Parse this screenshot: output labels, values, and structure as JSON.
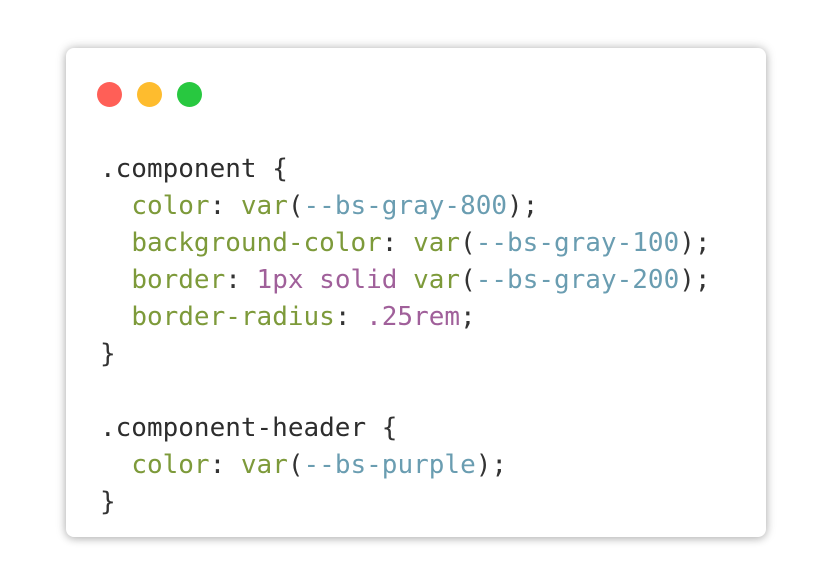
{
  "window": {
    "controls": [
      {
        "name": "close-dot",
        "color": "#ff5f57"
      },
      {
        "name": "minimize-dot",
        "color": "#febc2e"
      },
      {
        "name": "zoom-dot",
        "color": "#28c840"
      }
    ]
  },
  "code": {
    "lines": [
      [
        {
          "t": "sel",
          "v": ".component "
        },
        {
          "t": "punc",
          "v": "{"
        }
      ],
      [
        {
          "t": "punc",
          "v": "  "
        },
        {
          "t": "prop",
          "v": "color"
        },
        {
          "t": "punc",
          "v": ": "
        },
        {
          "t": "func",
          "v": "var"
        },
        {
          "t": "punc",
          "v": "("
        },
        {
          "t": "var",
          "v": "--bs-gray-800"
        },
        {
          "t": "punc",
          "v": ");"
        }
      ],
      [
        {
          "t": "punc",
          "v": "  "
        },
        {
          "t": "prop",
          "v": "background-color"
        },
        {
          "t": "punc",
          "v": ": "
        },
        {
          "t": "func",
          "v": "var"
        },
        {
          "t": "punc",
          "v": "("
        },
        {
          "t": "var",
          "v": "--bs-gray-100"
        },
        {
          "t": "punc",
          "v": ");"
        }
      ],
      [
        {
          "t": "punc",
          "v": "  "
        },
        {
          "t": "prop",
          "v": "border"
        },
        {
          "t": "punc",
          "v": ": "
        },
        {
          "t": "num",
          "v": "1px"
        },
        {
          "t": "punc",
          "v": " "
        },
        {
          "t": "kw",
          "v": "solid"
        },
        {
          "t": "punc",
          "v": " "
        },
        {
          "t": "func",
          "v": "var"
        },
        {
          "t": "punc",
          "v": "("
        },
        {
          "t": "var",
          "v": "--bs-gray-200"
        },
        {
          "t": "punc",
          "v": ");"
        }
      ],
      [
        {
          "t": "punc",
          "v": "  "
        },
        {
          "t": "prop",
          "v": "border-radius"
        },
        {
          "t": "punc",
          "v": ": "
        },
        {
          "t": "num",
          "v": ".25rem"
        },
        {
          "t": "punc",
          "v": ";"
        }
      ],
      [
        {
          "t": "punc",
          "v": "}"
        }
      ],
      [],
      [
        {
          "t": "sel",
          "v": ".component-header "
        },
        {
          "t": "punc",
          "v": "{"
        }
      ],
      [
        {
          "t": "punc",
          "v": "  "
        },
        {
          "t": "prop",
          "v": "color"
        },
        {
          "t": "punc",
          "v": ": "
        },
        {
          "t": "func",
          "v": "var"
        },
        {
          "t": "punc",
          "v": "("
        },
        {
          "t": "var",
          "v": "--bs-purple"
        },
        {
          "t": "punc",
          "v": ");"
        }
      ],
      [
        {
          "t": "punc",
          "v": "}"
        }
      ]
    ]
  }
}
